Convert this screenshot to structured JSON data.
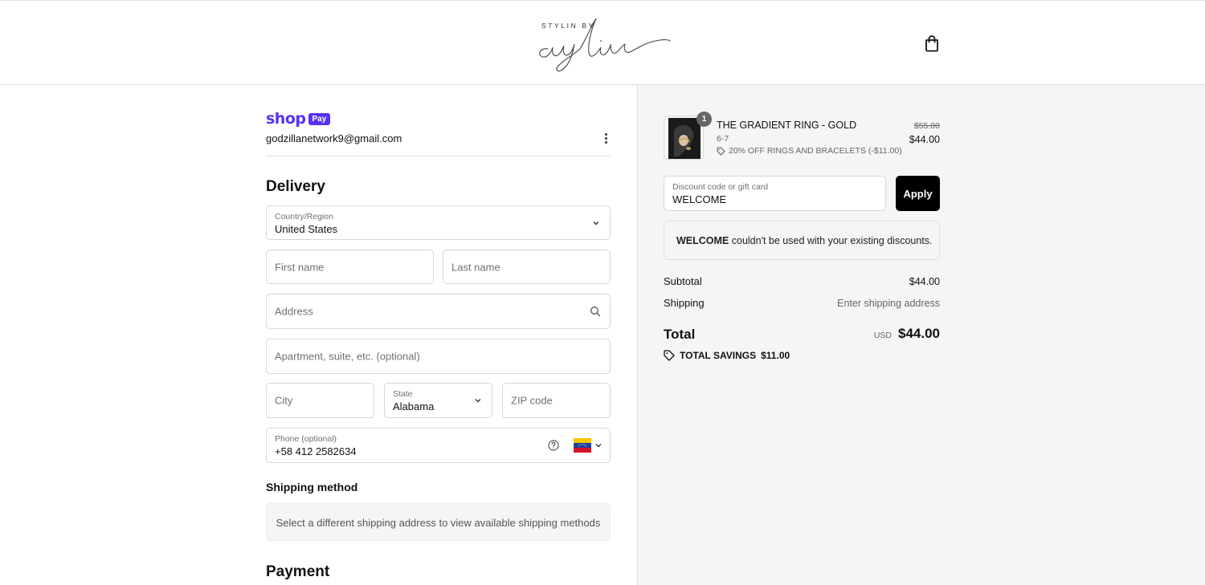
{
  "header": {
    "logo_top": "STYLIN BY",
    "logo_script": "aylin"
  },
  "express": {
    "shop_word": "shop",
    "pay_badge": "Pay",
    "email": "godzillanetwork9@gmail.com"
  },
  "delivery": {
    "title": "Delivery",
    "country": {
      "label": "Country/Region",
      "value": "United States"
    },
    "first_name": {
      "placeholder": "First name"
    },
    "last_name": {
      "placeholder": "Last name"
    },
    "address": {
      "placeholder": "Address"
    },
    "apartment": {
      "placeholder": "Apartment, suite, etc. (optional)"
    },
    "city": {
      "placeholder": "City"
    },
    "state": {
      "label": "State",
      "value": "Alabama"
    },
    "zip": {
      "placeholder": "ZIP code"
    },
    "phone": {
      "label": "Phone (optional)",
      "value": "+58 412 2582634"
    }
  },
  "shipping_method": {
    "title": "Shipping method",
    "message": "Select a different shipping address to view available shipping methods"
  },
  "payment": {
    "title": "Payment"
  },
  "order": {
    "item": {
      "quantity": "1",
      "name": "THE GRADIENT RING - GOLD",
      "variant": "6-7",
      "discount": "20% OFF RINGS AND BRACELETS (-$11.00)",
      "original_price": "$55.00",
      "price": "$44.00"
    },
    "discount_field": {
      "label": "Discount code or gift card",
      "value": "WELCOME"
    },
    "apply_label": "Apply",
    "discount_message": {
      "code": "WELCOME",
      "text": " couldn't be used with your existing discounts."
    },
    "subtotal": {
      "label": "Subtotal",
      "value": "$44.00"
    },
    "shipping": {
      "label": "Shipping",
      "value": "Enter shipping address"
    },
    "total": {
      "label": "Total",
      "currency": "USD",
      "value": "$44.00"
    },
    "savings": {
      "label": "TOTAL SAVINGS",
      "value": "$11.00"
    }
  },
  "colors": {
    "shop_pay": "#5a31f4",
    "apply_button": "#000000",
    "summary_bg": "#f5f5f5"
  }
}
